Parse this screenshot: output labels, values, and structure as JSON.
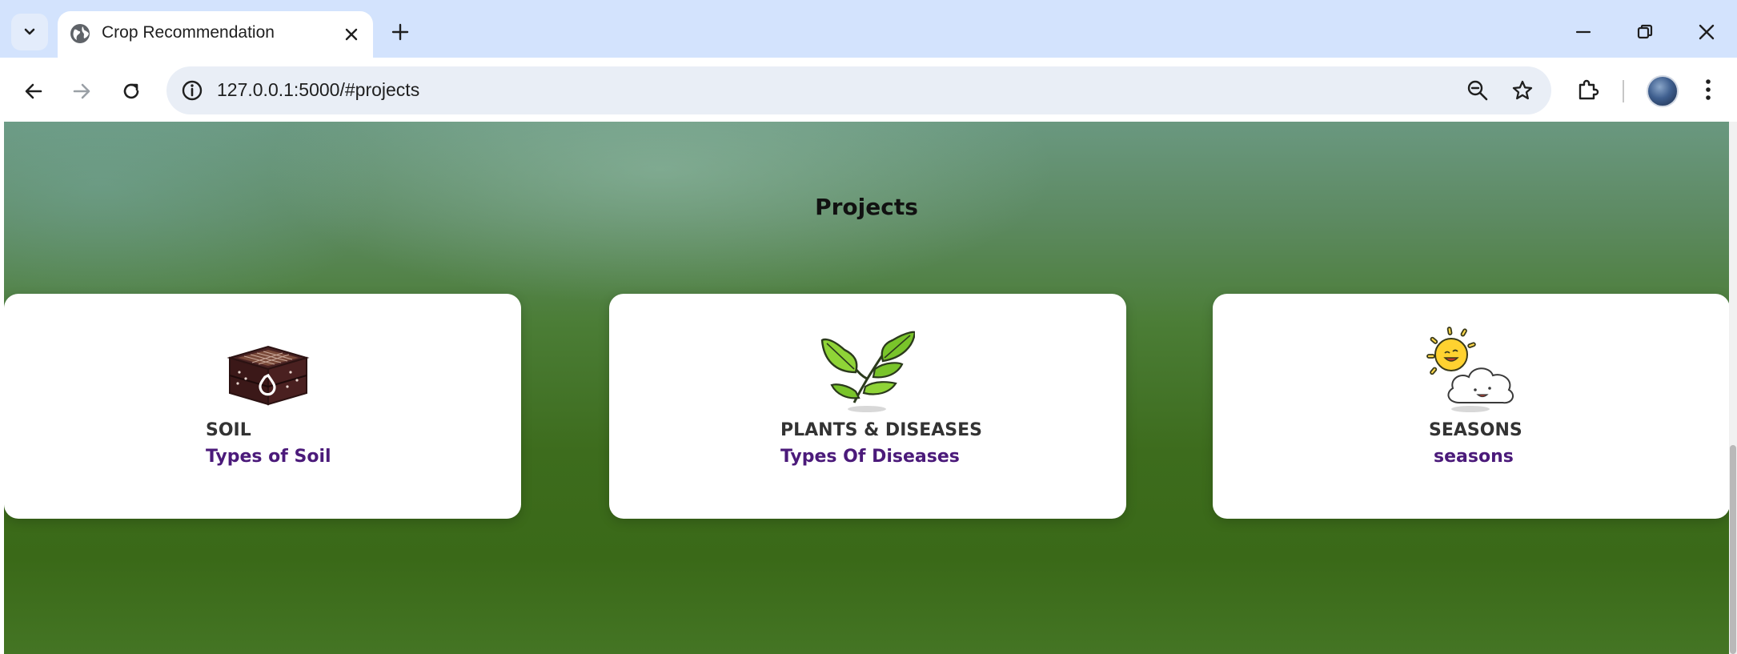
{
  "browser": {
    "tab": {
      "title": "Crop Recommendation"
    },
    "address": {
      "url": "127.0.0.1:5000/#projects"
    }
  },
  "page": {
    "title": "Projects",
    "cards": [
      {
        "name": "SOIL",
        "link": "Types of Soil",
        "icon": "soil-crate-icon"
      },
      {
        "name": "PLANTS & DISEASES",
        "link": "Types Of Diseases",
        "icon": "plant-leaves-icon"
      },
      {
        "name": "SEASONS",
        "link": "seasons",
        "icon": "sun-cloud-icon"
      }
    ]
  },
  "colors": {
    "tabbar": "#d3e3fd",
    "link": "#4b1a7a",
    "page_green": "#3d6c1d"
  }
}
